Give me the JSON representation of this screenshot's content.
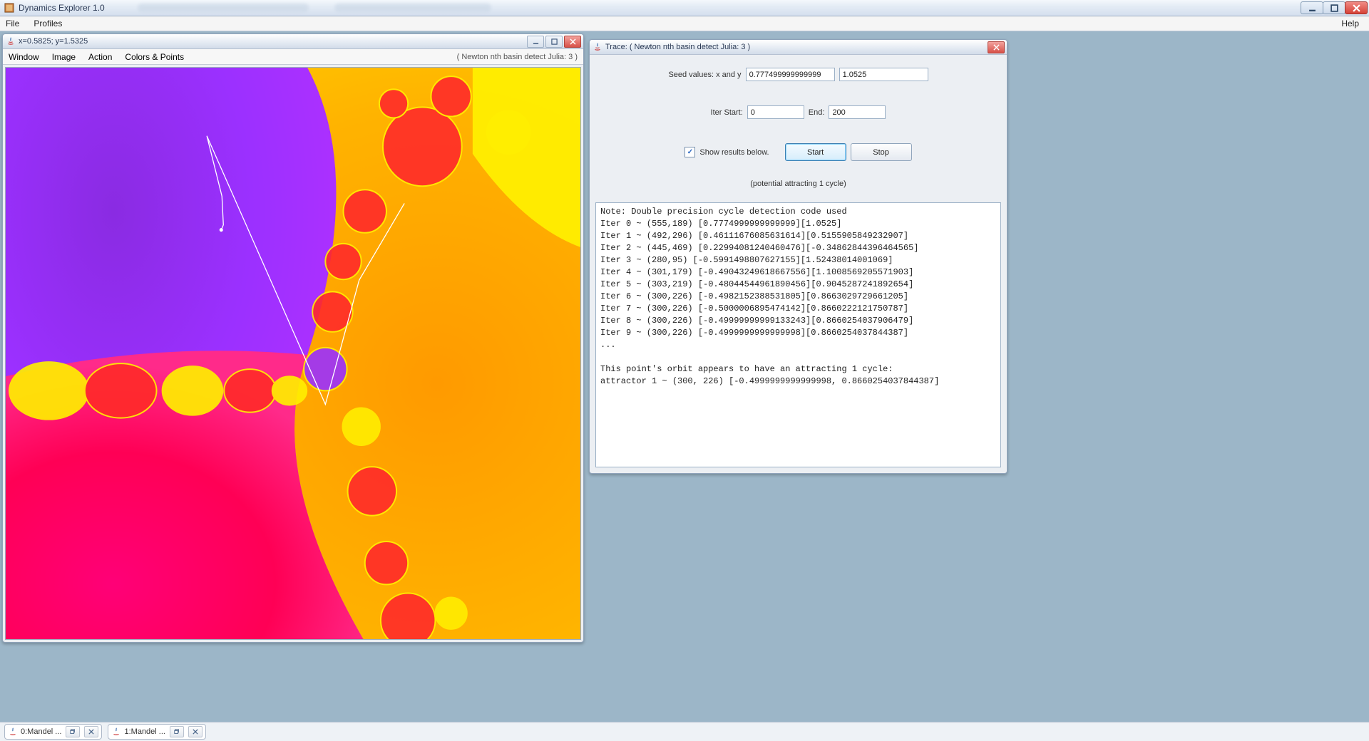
{
  "app": {
    "title": "Dynamics Explorer 1.0"
  },
  "main_menu": {
    "file": "File",
    "profiles": "Profiles",
    "help": "Help"
  },
  "fractal_window": {
    "coords_title": "x=0.5825; y=1.5325",
    "menu": {
      "window": "Window",
      "image": "Image",
      "action": "Action",
      "colors": "Colors & Points"
    },
    "context_label": "( Newton nth basin detect Julia: 3 )"
  },
  "trace_window": {
    "title": "Trace: ( Newton nth basin detect Julia: 3 )",
    "seed_label": "Seed values: x and y",
    "seed_x": "0.777499999999999",
    "seed_y": "1.0525",
    "iter_start_label": "Iter Start:",
    "iter_start": "0",
    "iter_end_label": "End:",
    "iter_end": "200",
    "show_results_label": "Show results below.",
    "show_results_checked": true,
    "start_btn": "Start",
    "stop_btn": "Stop",
    "status": "(potential attracting 1 cycle)",
    "results": "Note: Double precision cycle detection code used\nIter 0 ~ (555,189) [0.7774999999999999][1.0525]\nIter 1 ~ (492,296) [0.46111676085631614][0.5155905849232907]\nIter 2 ~ (445,469) [0.22994081240460476][-0.34862844396464565]\nIter 3 ~ (280,95) [-0.5991498807627155][1.52438014001069]\nIter 4 ~ (301,179) [-0.49043249618667556][1.1008569205571903]\nIter 5 ~ (303,219) [-0.48044544961890456][0.9045287241892654]\nIter 6 ~ (300,226) [-0.49821523885318​05][0.8663029729661205]\nIter 7 ~ (300,226) [-0.5000006895474142][0.8660222121750787]\nIter 8 ~ (300,226) [-0.49999999999133243][0.8660254037906479]\nIter 9 ~ (300,226) [-0.4999999999999998][0.8660254037844387]\n...\n\nThis point's orbit appears to have an attracting 1 cycle:\nattractor 1 ~ (300, 226) [-0.4999999999999998, 0.8660254037844387]"
  },
  "taskbar": {
    "item0": "0:Mandel ...",
    "item1": "1:Mandel ..."
  }
}
